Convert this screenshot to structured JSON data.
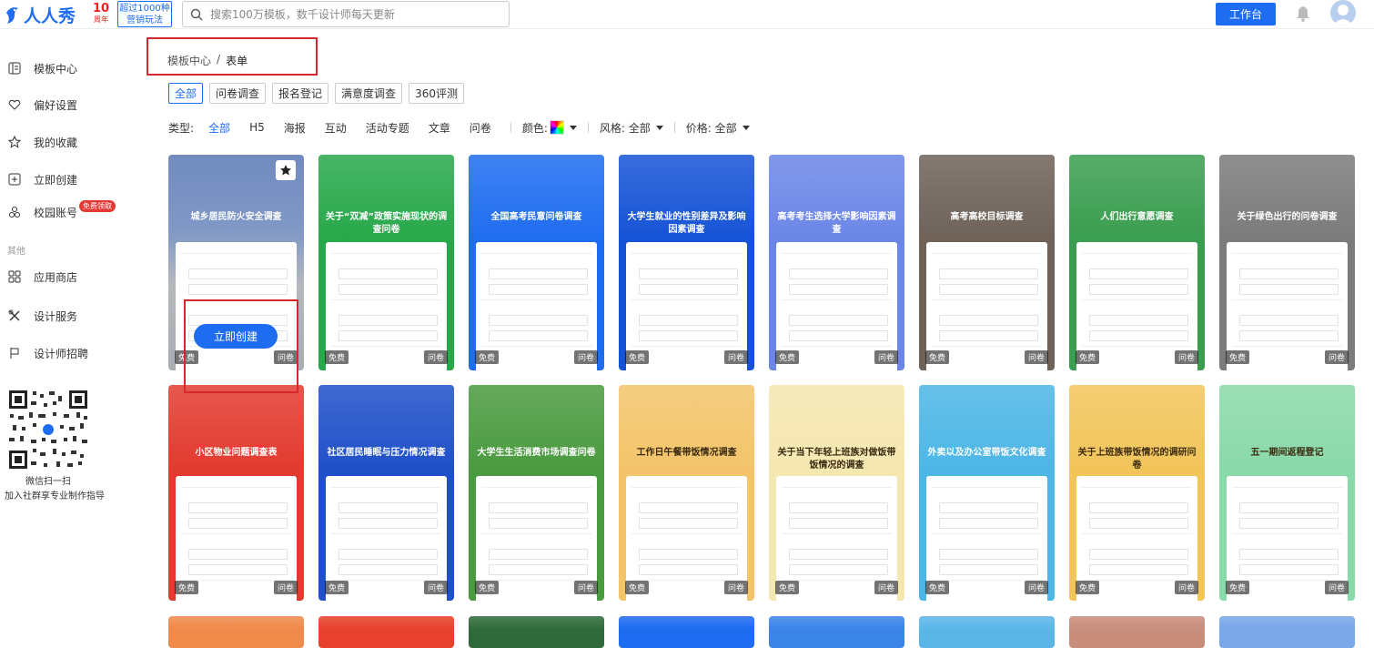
{
  "header": {
    "logo_text": "人人秀",
    "anniversary_number": "10",
    "anniversary_text": "周年",
    "promo_line1": "超过1000种",
    "promo_line2": "营销玩法",
    "search_placeholder": "搜索100万模板，数千设计师每天更新",
    "workbench_label": "工作台"
  },
  "sidebar": {
    "items": [
      {
        "label": "模板中心",
        "icon": "template-center-icon"
      },
      {
        "label": "偏好设置",
        "icon": "heart-icon"
      },
      {
        "label": "我的收藏",
        "icon": "star-icon"
      },
      {
        "label": "立即创建",
        "icon": "plus-square-icon"
      },
      {
        "label": "校园账号",
        "icon": "campus-icon"
      }
    ],
    "badge": "免费领取",
    "section_other": "其他",
    "other_items": [
      {
        "label": "应用商店",
        "icon": "apps-icon"
      },
      {
        "label": "设计服务",
        "icon": "tools-icon"
      },
      {
        "label": "设计师招聘",
        "icon": "flag-icon"
      }
    ],
    "qr_caption1": "微信扫一扫",
    "qr_caption2": "加入社群享专业制作指导"
  },
  "breadcrumb": {
    "root": "模板中心",
    "sep": "/",
    "current": "表单"
  },
  "tags": [
    "全部",
    "问卷调查",
    "报名登记",
    "满意度调查",
    "360评测"
  ],
  "filters": {
    "type_label": "类型:",
    "types": [
      "全部",
      "H5",
      "海报",
      "互动",
      "活动专题",
      "文章",
      "问卷"
    ],
    "color_label": "颜色:",
    "style_label": "风格: 全部",
    "price_label": "价格: 全部"
  },
  "card_labels": {
    "free": "免费",
    "kind": "问卷",
    "create": "立即创建"
  },
  "cards": [
    {
      "title": "城乡居民防火安全调查",
      "color": "#6c87b8"
    },
    {
      "title": "关于“双减”政策实施现状的调查问卷",
      "color": "#27a84a"
    },
    {
      "title": "全国高考民意问卷调查",
      "color": "#1e6cf0"
    },
    {
      "title": "大学生就业的性别差异及影响因素调查",
      "color": "#1553d6"
    },
    {
      "title": "高考考生选择大学影响因素调查",
      "color": "#6b86e6"
    },
    {
      "title": "高考高校目标调查",
      "color": "#6e6259"
    },
    {
      "title": "人们出行意愿调查",
      "color": "#3a9d4f"
    },
    {
      "title": "关于绿色出行的问卷调查",
      "color": "#7b7b7b"
    },
    {
      "title": "小区物业问题调查表",
      "color": "#e23a2e"
    },
    {
      "title": "社区居民睡眠与压力情况调查",
      "color": "#1f4fc9"
    },
    {
      "title": "大学生生活消费市场调查问卷",
      "color": "#4a9a3f"
    },
    {
      "title": "工作日午餐带饭情况调查",
      "color": "#f3c46a"
    },
    {
      "title": "关于当下年轻上班族对做饭带饭情况的调查",
      "color": "#f5e7b0"
    },
    {
      "title": "外卖以及办公室带饭文化调查",
      "color": "#4cb6e6"
    },
    {
      "title": "关于上班族带饭情况的调研问卷",
      "color": "#f2c55a"
    },
    {
      "title": "五一期间返程登记",
      "color": "#8ad9a9"
    },
    {
      "title": "",
      "color": "#f08a4b"
    },
    {
      "title": "",
      "color": "#e8412d"
    },
    {
      "title": "",
      "color": "#2f6b3a"
    },
    {
      "title": "",
      "color": "#1e6cf0"
    },
    {
      "title": "",
      "color": "#3b84e8"
    },
    {
      "title": "",
      "color": "#5bb6e8"
    },
    {
      "title": "",
      "color": "#c98d7c"
    },
    {
      "title": "",
      "color": "#7aa7e8"
    }
  ]
}
